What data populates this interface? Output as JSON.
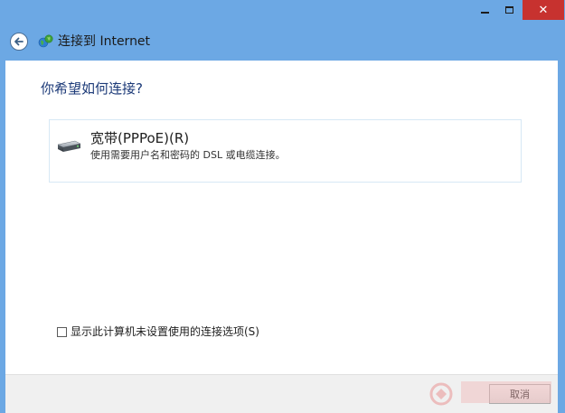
{
  "window": {
    "controls": {
      "minimize_icon": "minimize-icon",
      "maximize_icon": "maximize-icon",
      "close_icon": "close-icon",
      "close_glyph": "✕",
      "close_color": "#c7322f"
    }
  },
  "header": {
    "back_icon": "back-arrow-icon",
    "network_icon": "network-globe-icon",
    "title": "连接到 Internet"
  },
  "main": {
    "question": "你希望如何连接?",
    "options": [
      {
        "icon": "broadband-drive-icon",
        "title": "宽带(PPPoE)(R)",
        "description": "使用需要用户名和密码的 DSL 或电缆连接。"
      }
    ],
    "show_unsetup_checkbox": {
      "checked": false,
      "label": "显示此计算机未设置使用的连接选项(S)"
    }
  },
  "footer": {
    "cancel_label": "取消"
  },
  "colors": {
    "window_frame": "#6ca8e4",
    "question_text": "#1c3a78",
    "card_border": "#d7e8f5"
  }
}
